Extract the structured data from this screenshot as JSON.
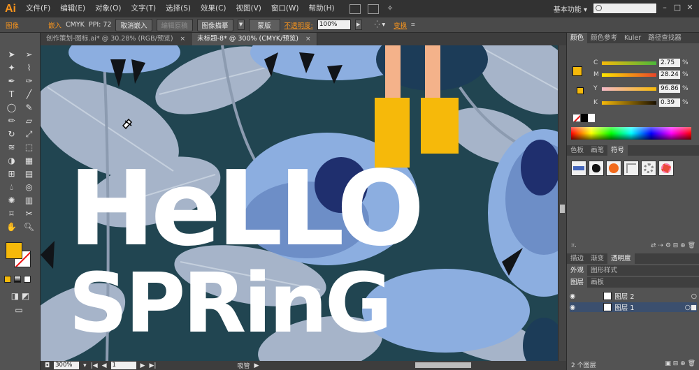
{
  "app": {
    "logo": "Ai",
    "menu": [
      "文件(F)",
      "编辑(E)",
      "对象(O)",
      "文字(T)",
      "选择(S)",
      "效果(C)",
      "视图(V)",
      "窗口(W)",
      "帮助(H)"
    ],
    "workspace": "基本功能",
    "workspace_arrow": "▾"
  },
  "control_bar": {
    "image_label": "图像",
    "embed": "嵌入",
    "colormode": "CMYK",
    "ppi": "PPI: 72",
    "unembed": "取消嵌入",
    "edit_original": "编辑原稿",
    "image_trace": "图像描摹",
    "mask": "蒙版",
    "opacity_label": "不透明度:",
    "opacity_value": "100%",
    "transform": "变换"
  },
  "tabs": [
    {
      "label": "创作策划-图标.ai* @ 30.28% (RGB/预览)",
      "close": "×"
    },
    {
      "label": "未标题-8* @ 300% (CMYK/预览)",
      "close": "×"
    }
  ],
  "artwork": {
    "line1": "HeLLO",
    "line2": "SPRinG",
    "colors": {
      "background": "#214551",
      "leaf": "#a6b4c9",
      "flower": "#8caee0",
      "text": "#ffffff",
      "boot": "#f6b90a",
      "skin": "#f4b28a"
    }
  },
  "status_bar": {
    "zoom": "300%",
    "page": "1",
    "label": "吸管"
  },
  "color_panel": {
    "tabs": [
      "颜色",
      "颜色参考",
      "Kuler",
      "路径查找器"
    ],
    "channels": [
      {
        "label": "C",
        "value": "2.75",
        "pct": "%"
      },
      {
        "label": "M",
        "value": "28.24",
        "pct": "%"
      },
      {
        "label": "Y",
        "value": "96.86",
        "pct": "%"
      },
      {
        "label": "K",
        "value": "0.39",
        "pct": "%"
      }
    ]
  },
  "swatch_panel": {
    "tabs": [
      "色板",
      "画笔",
      "符号"
    ]
  },
  "stroke_panel": {
    "tabs": [
      "描边",
      "渐变",
      "透明度"
    ]
  },
  "appearance_panel": {
    "tabs": [
      "外观",
      "图形样式"
    ]
  },
  "layers_panel": {
    "tabs": [
      "图层",
      "画板"
    ],
    "layers": [
      "图层 2",
      "图层 1"
    ],
    "count": "2 个图层"
  }
}
